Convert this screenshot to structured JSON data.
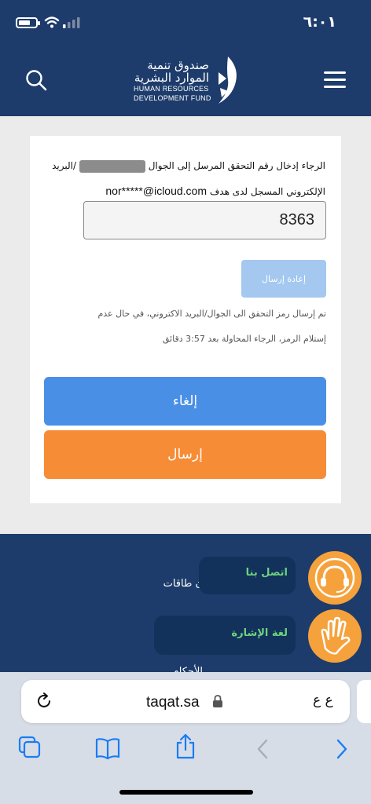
{
  "status_bar": {
    "time": "٦:٠١"
  },
  "header": {
    "logo_ar_line1": "صندوق تنمية",
    "logo_ar_line2": "الموارد البشرية",
    "logo_en_line1": "HUMAN RESOURCES",
    "logo_en_line2": "DEVELOPMENT FUND"
  },
  "verification": {
    "instruction_part1": "الرجاء إدخال رقم التحقق المرسل إلى الجوال",
    "instruction_part2": "/البريد الإلكتروني المسجل لدى هدف",
    "email": "nor*****@icloud.com",
    "code_value": "8363",
    "resend_label": "إعادة إرسال",
    "resend_note_line1": "تم إرسال رمز التحقق الى الجوال/البريد الاكتروني، في حال عدم",
    "resend_note_line2": "إستلام الرمز، الرجاء المحاولة بعد 3:57 دقائق",
    "cancel_label": "إلغاء",
    "send_label": "إرسال"
  },
  "footer": {
    "partial_text_1": "ن طاقات",
    "partial_text_2": "الأحكام",
    "contact_label": "اتصل بنا",
    "sign_language_label": "لغة الإشارة"
  },
  "browser": {
    "url": "taqat.sa",
    "text_size_label": "ع ع"
  },
  "colors": {
    "header_bg": "#1d3c6b",
    "cancel_button": "#4a8fe6",
    "send_button": "#f78c37",
    "resend_button_disabled": "#a4c8f0",
    "widget_accent": "#f5a23d",
    "widget_label": "#6fd37e"
  },
  "icons": {
    "status_bar": [
      "battery-icon",
      "wifi-icon",
      "signal-icon"
    ],
    "header": [
      "search-icon",
      "menu-icon",
      "hrdf-logo-icon"
    ],
    "widgets": [
      "headset-icon",
      "sign-language-hand-icon"
    ],
    "browser": [
      "reload-icon",
      "lock-icon",
      "tabs-icon",
      "bookmarks-icon",
      "share-icon",
      "back-icon",
      "forward-icon"
    ]
  }
}
